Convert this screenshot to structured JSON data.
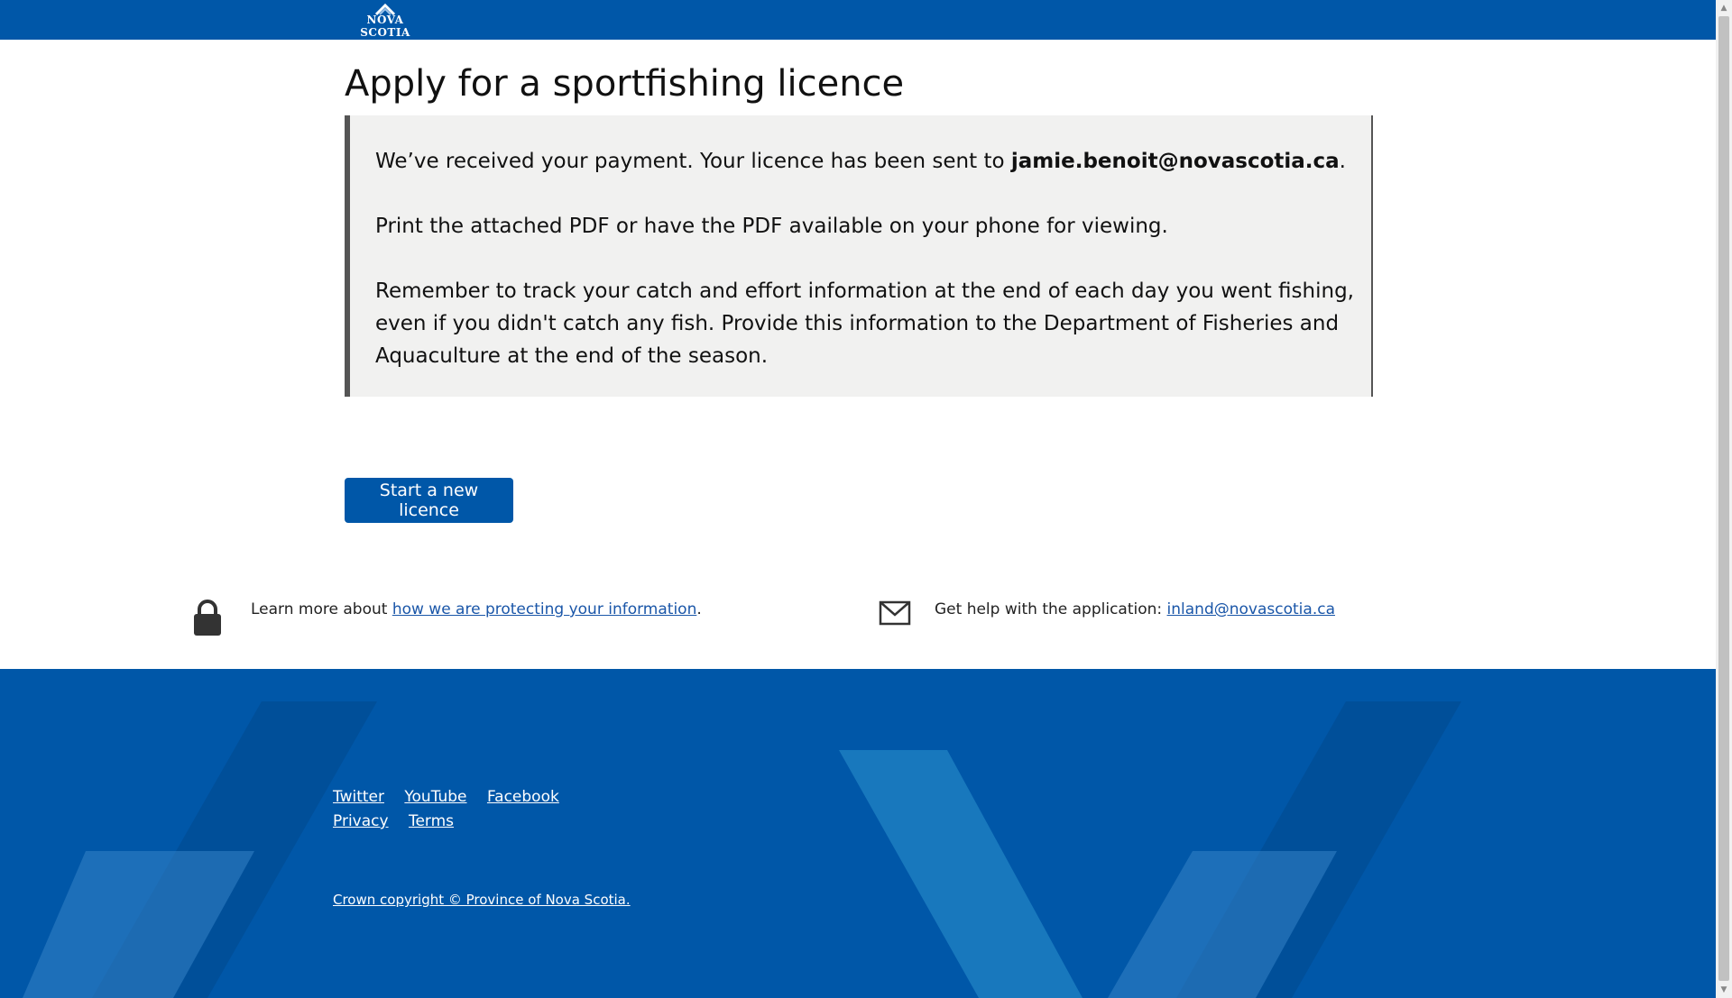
{
  "header": {
    "logo_text": "NOVA SCOTIA"
  },
  "page_title": "Apply for a sportfishing licence",
  "confirmation": {
    "line1_prefix": "We’ve received your payment. Your licence has been sent to ",
    "email": "jamie.benoit@novascotia.ca",
    "line1_suffix": ".",
    "line2": "Print the attached PDF or have the PDF available on your phone for viewing.",
    "line3": "Remember to track your catch and effort information at the end of each day you went fishing, even if you didn't catch any fish. Provide this information to the Department of Fisheries and Aquaculture at the end of the season."
  },
  "start_button_label": "Start a new licence",
  "privacy": {
    "prefix": "Learn more about ",
    "link": "how we are protecting your information",
    "suffix": "."
  },
  "help": {
    "prefix": "Get help with the application: ",
    "link": "inland@novascotia.ca"
  },
  "footer": {
    "social_links": [
      "Twitter",
      "YouTube",
      "Facebook"
    ],
    "legal_links": [
      "Privacy",
      "Terms"
    ],
    "copyright": "Crown copyright © Province of Nova Scotia."
  },
  "colors": {
    "brand_blue": "#0057a8",
    "panel_bg": "#f1f1f0",
    "link_blue": "#1a56a8"
  }
}
